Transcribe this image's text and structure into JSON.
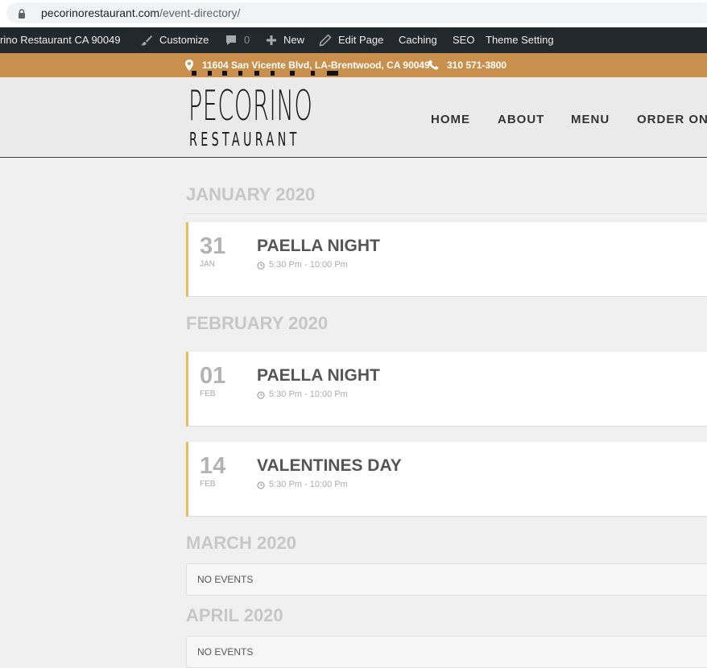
{
  "browser": {
    "url_domain": "pecorinorestaurant.com",
    "url_path": "/event-directory/"
  },
  "adminbar": {
    "site_name": "rino Restaurant CA 90049",
    "customize": "Customize",
    "comments_count": "0",
    "new": "New",
    "edit_page": "Edit Page",
    "caching": "Caching",
    "seo": "SEO",
    "theme_setting": "Theme Setting"
  },
  "infobar": {
    "address": "11604 San Vicente Blvd, LA-Brentwood, CA 90049",
    "phone": "310 571-3800",
    "accent": "#c9904d"
  },
  "header": {
    "logo_main": "PECORINO",
    "logo_sub": "RESTAURANT",
    "nav": [
      "HOME",
      "ABOUT",
      "MENU",
      "ORDER ON"
    ]
  },
  "months": [
    {
      "label": "JANUARY 2020",
      "events": [
        {
          "day": "31",
          "month": "JAN",
          "title": "PAELLA NIGHT",
          "time": "5:30 Pm - 10:00 Pm"
        }
      ]
    },
    {
      "label": "FEBRUARY 2020",
      "events": [
        {
          "day": "01",
          "month": "FEB",
          "title": "PAELLA NIGHT",
          "time": "5:30 Pm - 10:00 Pm"
        },
        {
          "day": "14",
          "month": "FEB",
          "title": "VALENTINES DAY",
          "time": "5:30 Pm - 10:00 Pm"
        }
      ]
    },
    {
      "label": "MARCH 2020",
      "no_events": "NO EVENTS"
    },
    {
      "label": "APRIL 2020",
      "no_events": "NO EVENTS"
    }
  ],
  "colors": {
    "event_accent": "#e7bc5b",
    "adminbar_bg": "#23282d"
  }
}
